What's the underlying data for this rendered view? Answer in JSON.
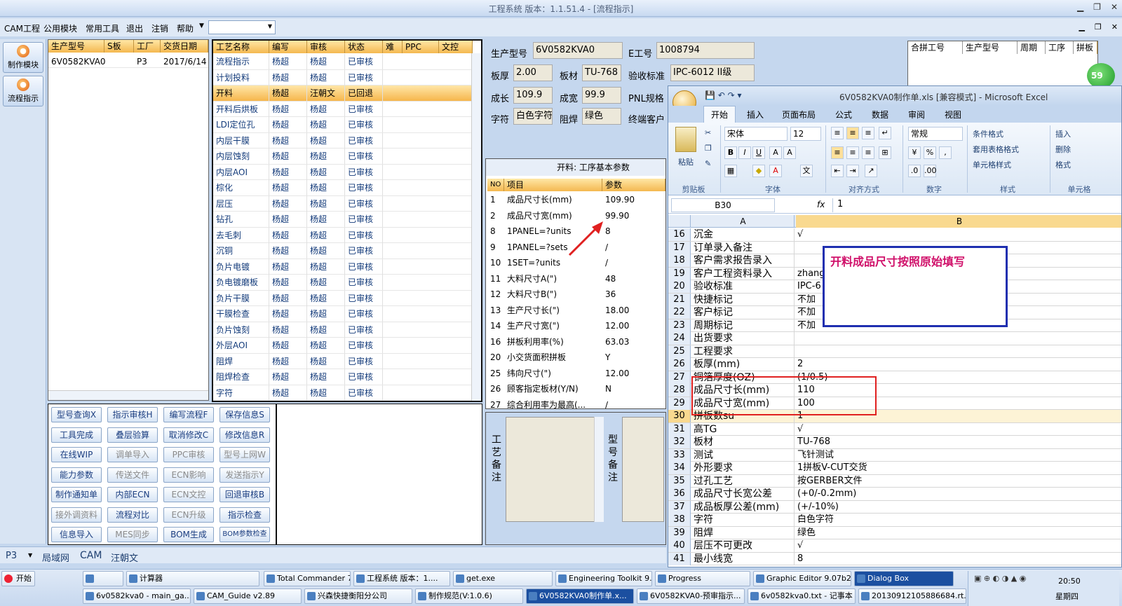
{
  "window": {
    "title": "工程系统   版本：1.1.51.4 - [流程指示]"
  },
  "menu": {
    "items": [
      "CAM工程",
      "公用模块",
      "常用工具",
      "退出",
      "注销",
      "帮助"
    ]
  },
  "leftnav": [
    {
      "label": "制作模块"
    },
    {
      "label": "流程指示"
    }
  ],
  "orders": {
    "headers": [
      "生产型号",
      "S板",
      "工厂",
      "交货日期"
    ],
    "rows": [
      {
        "model": "6V0582KVA0",
        "s": "",
        "factory": "P3",
        "date": "2017/6/14"
      }
    ]
  },
  "process": {
    "headers": [
      "工艺名称",
      "编写",
      "审核",
      "状态",
      "难",
      "PPC",
      "文控"
    ],
    "rows": [
      {
        "name": "流程指示",
        "w": "杨超",
        "r": "杨超",
        "s": "已审核"
      },
      {
        "name": "计划投料",
        "w": "杨超",
        "r": "杨超",
        "s": "已审核"
      },
      {
        "name": "开料",
        "w": "杨超",
        "r": "汪朝文",
        "s": "已回退",
        "sel": true
      },
      {
        "name": "开料后烘板",
        "w": "杨超",
        "r": "杨超",
        "s": "已审核"
      },
      {
        "name": "LDI定位孔",
        "w": "杨超",
        "r": "杨超",
        "s": "已审核"
      },
      {
        "name": "内层干膜",
        "w": "杨超",
        "r": "杨超",
        "s": "已审核"
      },
      {
        "name": "内层蚀刻",
        "w": "杨超",
        "r": "杨超",
        "s": "已审核"
      },
      {
        "name": "内层AOI",
        "w": "杨超",
        "r": "杨超",
        "s": "已审核"
      },
      {
        "name": "棕化",
        "w": "杨超",
        "r": "杨超",
        "s": "已审核"
      },
      {
        "name": "层压",
        "w": "杨超",
        "r": "杨超",
        "s": "已审核"
      },
      {
        "name": "钻孔",
        "w": "杨超",
        "r": "杨超",
        "s": "已审核"
      },
      {
        "name": "去毛刺",
        "w": "杨超",
        "r": "杨超",
        "s": "已审核"
      },
      {
        "name": "沉铜",
        "w": "杨超",
        "r": "杨超",
        "s": "已审核"
      },
      {
        "name": "负片电镀",
        "w": "杨超",
        "r": "杨超",
        "s": "已审核"
      },
      {
        "name": "负电镀磨板",
        "w": "杨超",
        "r": "杨超",
        "s": "已审核"
      },
      {
        "name": "负片干膜",
        "w": "杨超",
        "r": "杨超",
        "s": "已审核"
      },
      {
        "name": "干膜检查",
        "w": "杨超",
        "r": "杨超",
        "s": "已审核"
      },
      {
        "name": "负片蚀刻",
        "w": "杨超",
        "r": "杨超",
        "s": "已审核"
      },
      {
        "name": "外层AOI",
        "w": "杨超",
        "r": "杨超",
        "s": "已审核"
      },
      {
        "name": "阻焊",
        "w": "杨超",
        "r": "杨超",
        "s": "已审核"
      },
      {
        "name": "阻焊检查",
        "w": "杨超",
        "r": "杨超",
        "s": "已审核"
      },
      {
        "name": "字符",
        "w": "杨超",
        "r": "杨超",
        "s": "已审核"
      }
    ]
  },
  "buttons": [
    {
      "label": "型号查询X",
      "dis": false
    },
    {
      "label": "指示审核H",
      "dis": false
    },
    {
      "label": "编写流程F",
      "dis": false
    },
    {
      "label": "保存信息S",
      "dis": false
    },
    {
      "label": "工具完成",
      "dis": false
    },
    {
      "label": "叠层验算",
      "dis": false
    },
    {
      "label": "取消修改C",
      "dis": false
    },
    {
      "label": "修改信息R",
      "dis": false
    },
    {
      "label": "在线WIP",
      "dis": false
    },
    {
      "label": "调单导入",
      "dis": true
    },
    {
      "label": "PPC审核",
      "dis": true
    },
    {
      "label": "型号上网W",
      "dis": true
    },
    {
      "label": "能力参数",
      "dis": false
    },
    {
      "label": "传送文件",
      "dis": true
    },
    {
      "label": "ECN影响",
      "dis": true
    },
    {
      "label": "发送指示Y",
      "dis": true
    },
    {
      "label": "制作通知单",
      "dis": false
    },
    {
      "label": "内部ECN",
      "dis": false
    },
    {
      "label": "ECN文控",
      "dis": true
    },
    {
      "label": "回退审核B",
      "dis": false
    },
    {
      "label": "接外调资料",
      "dis": true
    },
    {
      "label": "流程对比",
      "dis": false
    },
    {
      "label": "ECN升级",
      "dis": true
    },
    {
      "label": "指示检查",
      "dis": false
    },
    {
      "label": "信息导入",
      "dis": false
    },
    {
      "label": "MES同步",
      "dis": true
    },
    {
      "label": "BOM生成",
      "dis": false
    },
    {
      "label": "BOM参数检查",
      "dis": false
    }
  ],
  "info": {
    "model_label": "生产型号",
    "model": "6V0582KVA0",
    "eno_label": "E工号",
    "eno": "1008794",
    "thick_label": "板厚",
    "thick": "2.00",
    "mat_label": "板材",
    "mat": "TU-768",
    "std_label": "验收标准",
    "std": "IPC-6012 II级",
    "len_label": "成长",
    "len": "109.9",
    "wid_label": "成宽",
    "wid": "99.9",
    "pnl_label": "PNL规格",
    "char_label": "字符",
    "char": "白色字符",
    "mask_label": "阻焊",
    "mask": "绿色",
    "cust_label": "终端客户"
  },
  "params": {
    "title": "开料: 工序基本参数",
    "h_no": "NO",
    "h_item": "项目",
    "h_val": "参数",
    "rows": [
      {
        "no": "1",
        "item": "成品尺寸长(mm)",
        "val": "109.90"
      },
      {
        "no": "2",
        "item": "成品尺寸宽(mm)",
        "val": "99.90"
      },
      {
        "no": "8",
        "item": "1PANEL=?units",
        "val": "8"
      },
      {
        "no": "9",
        "item": "1PANEL=?sets",
        "val": "/"
      },
      {
        "no": "10",
        "item": "1SET=?units",
        "val": "/"
      },
      {
        "no": "11",
        "item": "大料尺寸A(\")",
        "val": "48"
      },
      {
        "no": "12",
        "item": "大料尺寸B(\")",
        "val": "36"
      },
      {
        "no": "13",
        "item": "生产尺寸长(\")",
        "val": "18.00"
      },
      {
        "no": "14",
        "item": "生产尺寸宽(\")",
        "val": "12.00"
      },
      {
        "no": "16",
        "item": "拼板利用率(%)",
        "val": "63.03"
      },
      {
        "no": "20",
        "item": "小交货面积拼板",
        "val": "Y"
      },
      {
        "no": "25",
        "item": "纬向尺寸(\")",
        "val": "12.00"
      },
      {
        "no": "26",
        "item": "顾客指定板材(Y/N)",
        "val": "N"
      },
      {
        "no": "27",
        "item": "综合利用率为最高(...",
        "val": "/"
      }
    ]
  },
  "notes": {
    "left": "工艺备注",
    "right": "型号备注"
  },
  "merge": {
    "headers": [
      "合拼工号",
      "生产型号",
      "周期",
      "工序",
      "拼板"
    ],
    "badge": "59"
  },
  "excel": {
    "title": "6V0582KVA0制作单.xls  [兼容模式] - Microsoft Excel",
    "tabs": [
      "开始",
      "插入",
      "页面布局",
      "公式",
      "数据",
      "审阅",
      "视图"
    ],
    "font": "宋体",
    "size": "12",
    "numfmt": "常规",
    "groups": [
      "剪贴板",
      "字体",
      "对齐方式",
      "数字",
      "样式",
      "单元格"
    ],
    "styles": [
      "条件格式",
      "套用表格格式",
      "单元格样式"
    ],
    "cells": [
      "插入",
      "删除",
      "格式"
    ],
    "paste": "粘贴",
    "namebox": "B30",
    "formula": "1",
    "fx": "fx",
    "col_a": "A",
    "col_b": "B",
    "rows": [
      {
        "n": "16",
        "a": "沉金",
        "b": "√"
      },
      {
        "n": "17",
        "a": "订单录入备注",
        "b": ""
      },
      {
        "n": "18",
        "a": "客户需求报告录入",
        "b": ""
      },
      {
        "n": "19",
        "a": "客户工程资料录入",
        "b": "zhang"
      },
      {
        "n": "20",
        "a": "验收标准",
        "b": "IPC-6"
      },
      {
        "n": "21",
        "a": "快捷标记",
        "b": "不加"
      },
      {
        "n": "22",
        "a": "客户标记",
        "b": "不加"
      },
      {
        "n": "23",
        "a": "周期标记",
        "b": "不加"
      },
      {
        "n": "24",
        "a": "出货要求",
        "b": ""
      },
      {
        "n": "25",
        "a": "工程要求",
        "b": ""
      },
      {
        "n": "26",
        "a": "板厚(mm)",
        "b": "2"
      },
      {
        "n": "27",
        "a": "铜箔厚度(OZ)",
        "b": "(1/0.5)"
      },
      {
        "n": "28",
        "a": "成品尺寸长(mm)",
        "b": "110"
      },
      {
        "n": "29",
        "a": "成品尺寸宽(mm)",
        "b": "100"
      },
      {
        "n": "30",
        "a": "拼板数su",
        "b": "1"
      },
      {
        "n": "31",
        "a": "高TG",
        "b": "√"
      },
      {
        "n": "32",
        "a": "板材",
        "b": "TU-768"
      },
      {
        "n": "33",
        "a": "测试",
        "b": "飞针测试"
      },
      {
        "n": "34",
        "a": "外形要求",
        "b": "1拼板V-CUT交货"
      },
      {
        "n": "35",
        "a": "过孔工艺",
        "b": "按GERBER文件"
      },
      {
        "n": "36",
        "a": "成品尺寸长宽公差",
        "b": "(+0/-0.2mm)"
      },
      {
        "n": "37",
        "a": "成品板厚公差(mm)",
        "b": "(+/-10%)"
      },
      {
        "n": "38",
        "a": "字符",
        "b": "白色字符"
      },
      {
        "n": "39",
        "a": "阻焊",
        "b": "绿色"
      },
      {
        "n": "40",
        "a": "层压不可更改",
        "b": "√"
      },
      {
        "n": "41",
        "a": "最小线宽",
        "b": "8"
      }
    ]
  },
  "annotation": {
    "text": "开料成品尺寸按照原始填写"
  },
  "statusbar": {
    "items": [
      "P3",
      "局域网",
      "CAM",
      "汪朝文"
    ]
  },
  "taskbar": {
    "start": "开始",
    "clock": "20:50",
    "weekday": "星期四",
    "row1": [
      "",
      "计算器",
      "Total Commander 7.0...",
      "工程系统  版本：1....",
      "get.exe",
      "Engineering Toolkit 9....",
      "Progress",
      "Graphic Editor 9.07b2...",
      "Dialog Box"
    ],
    "row2": [
      "6v0582kva0 - main_ga...",
      "CAM_Guide v2.89",
      "兴森快捷衡阳分公司",
      "制作规范(V:1.0.6)",
      "6V0582KVA0制作单.x...",
      "6V0582KVA0-预审指示...",
      "6v0582kva0.txt - 记事本",
      "20130912105886684.rt..."
    ]
  },
  "colors": {
    "accent": "#f4b850",
    "annotation": "#1f2fb0",
    "annotation_text": "#d0106a",
    "redbox": "#e02020"
  }
}
